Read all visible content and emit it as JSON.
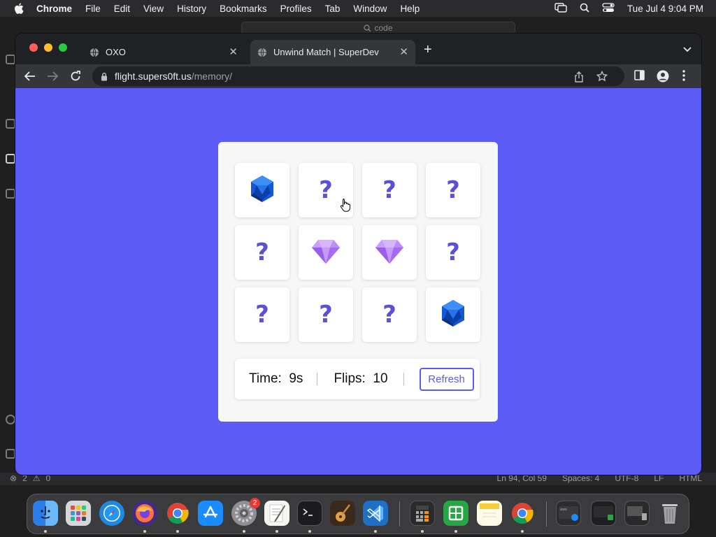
{
  "menubar": {
    "app": "Chrome",
    "items": [
      "File",
      "Edit",
      "View",
      "History",
      "Bookmarks",
      "Profiles",
      "Tab",
      "Window",
      "Help"
    ],
    "clock": "Tue Jul 4  9:04 PM"
  },
  "editor": {
    "search": "code",
    "status_errors": "2",
    "status_warnings": "0",
    "status_right": [
      "Ln 94, Col 59",
      "Spaces: 4",
      "UTF-8",
      "LF",
      "HTML"
    ]
  },
  "browser": {
    "tabs": [
      {
        "title": "OXO",
        "active": false
      },
      {
        "title": "Unwind Match | SuperDev",
        "active": true
      }
    ],
    "url_host": "flight.supers0ft.us",
    "url_path": "/memory/"
  },
  "game": {
    "background": "#5b5bf5",
    "cards": [
      {
        "face": "blue-gem-icon"
      },
      {
        "face": "?"
      },
      {
        "face": "?"
      },
      {
        "face": "?"
      },
      {
        "face": "?"
      },
      {
        "face": "purple-diamond-icon"
      },
      {
        "face": "purple-diamond-icon"
      },
      {
        "face": "?"
      },
      {
        "face": "?"
      },
      {
        "face": "?"
      },
      {
        "face": "?"
      },
      {
        "face": "blue-gem-icon"
      }
    ],
    "time_label": "Time:",
    "time_value": "9s",
    "flips_label": "Flips:",
    "flips_value": "10",
    "refresh_label": "Refresh"
  },
  "dock": {
    "apps": [
      "Finder",
      "Launchpad",
      "Safari",
      "Firefox",
      "Chrome",
      "App Store",
      "System Settings",
      "TextEdit",
      "Terminal",
      "GarageBand",
      "VS Code",
      "Calculator",
      "Numbers",
      "Notes",
      "Chrome"
    ],
    "settings_badge": "2"
  }
}
